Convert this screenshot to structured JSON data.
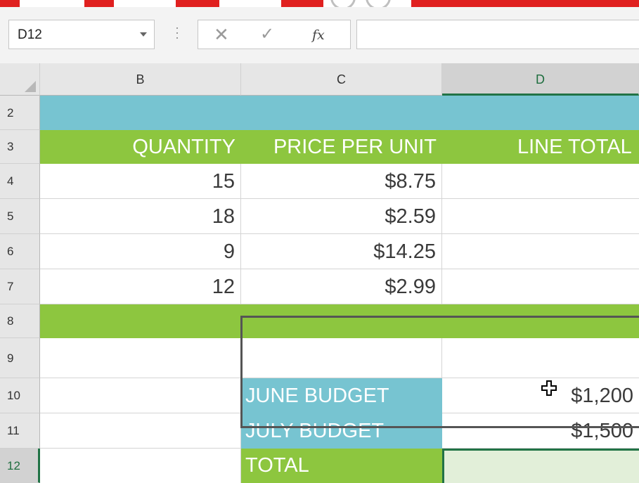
{
  "formula_bar": {
    "name_box": "D12",
    "cancel_glyph": "✕",
    "enter_glyph": "✓",
    "function_glyph": "fx",
    "formula_value": ""
  },
  "columns": [
    "B",
    "C",
    "D"
  ],
  "rows": [
    "2",
    "3",
    "4",
    "5",
    "6",
    "7",
    "8",
    "9",
    "10",
    "11",
    "12"
  ],
  "headers": {
    "quantity": "QUANTITY",
    "price_per_unit": "PRICE PER UNIT",
    "line_total": "LINE TOTAL"
  },
  "items": [
    {
      "quantity": "15",
      "price": "$8.75"
    },
    {
      "quantity": "18",
      "price": "$2.59"
    },
    {
      "quantity": "9",
      "price": "$14.25"
    },
    {
      "quantity": "12",
      "price": "$2.99"
    }
  ],
  "budget": {
    "june_label": "JUNE BUDGET",
    "june_value": "$1,200",
    "july_label": "JULY BUDGET",
    "july_value": "$1,500",
    "total_label": "TOTAL"
  },
  "selection": {
    "cell": "D12",
    "column": "D",
    "row": "12"
  },
  "colors": {
    "band_blue": "#77c4d1",
    "band_green": "#8dc63f",
    "selection_green": "#217346",
    "selected_cell_fill": "#e2efd9"
  },
  "icons": {
    "name_box_dropdown": "chevron-down-icon",
    "cancel": "close-icon",
    "enter": "checkmark-icon",
    "insert_function": "fx-icon",
    "cursor": "cell-select-cross-cursor-icon"
  }
}
